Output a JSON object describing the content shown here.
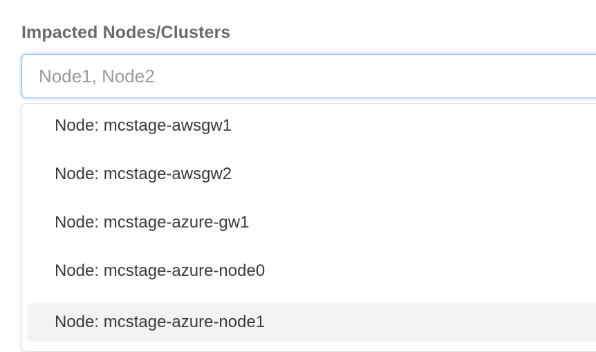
{
  "field": {
    "label": "Impacted Nodes/Clusters",
    "placeholder": "Node1, Node2",
    "value": ""
  },
  "dropdown": {
    "options": [
      {
        "label": "Node: mcstage-awsgw1",
        "highlighted": false
      },
      {
        "label": "Node: mcstage-awsgw2",
        "highlighted": false
      },
      {
        "label": "Node: mcstage-azure-gw1",
        "highlighted": false
      },
      {
        "label": "Node: mcstage-azure-node0",
        "highlighted": false
      },
      {
        "label": "Node: mcstage-azure-node1",
        "highlighted": true
      }
    ]
  },
  "colors": {
    "label_text": "#6b6b6b",
    "focus_border": "#7fb1e8",
    "placeholder": "#9a9a9a",
    "option_text": "#3a3a3a",
    "highlight_bg": "#f3f3f3"
  }
}
